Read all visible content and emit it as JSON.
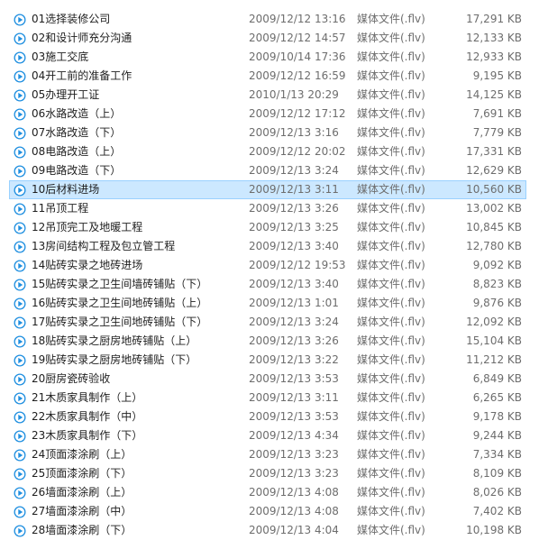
{
  "icon": {
    "name": "flv-video-icon",
    "color": "#1f8fe0"
  },
  "selected_index": 9,
  "files": [
    {
      "name": "01选择装修公司",
      "date": "2009/12/12 13:16",
      "type": "媒体文件(.flv)",
      "size": "17,291 KB"
    },
    {
      "name": "02和设计师充分沟通",
      "date": "2009/12/12 14:57",
      "type": "媒体文件(.flv)",
      "size": "12,133 KB"
    },
    {
      "name": "03施工交底",
      "date": "2009/10/14 17:36",
      "type": "媒体文件(.flv)",
      "size": "12,933 KB"
    },
    {
      "name": "04开工前的准备工作",
      "date": "2009/12/12 16:59",
      "type": "媒体文件(.flv)",
      "size": "9,195 KB"
    },
    {
      "name": "05办理开工证",
      "date": "2010/1/13 20:29",
      "type": "媒体文件(.flv)",
      "size": "14,125 KB"
    },
    {
      "name": "06水路改造（上）",
      "date": "2009/12/12 17:12",
      "type": "媒体文件(.flv)",
      "size": "7,691 KB"
    },
    {
      "name": "07水路改造（下）",
      "date": "2009/12/13 3:16",
      "type": "媒体文件(.flv)",
      "size": "7,779 KB"
    },
    {
      "name": "08电路改造（上）",
      "date": "2009/12/12 20:02",
      "type": "媒体文件(.flv)",
      "size": "17,331 KB"
    },
    {
      "name": "09电路改造（下）",
      "date": "2009/12/13 3:24",
      "type": "媒体文件(.flv)",
      "size": "12,629 KB"
    },
    {
      "name": "10后材料进场",
      "date": "2009/12/13 3:11",
      "type": "媒体文件(.flv)",
      "size": "10,560 KB"
    },
    {
      "name": "11吊顶工程",
      "date": "2009/12/13 3:26",
      "type": "媒体文件(.flv)",
      "size": "13,002 KB"
    },
    {
      "name": "12吊顶完工及地暖工程",
      "date": "2009/12/13 3:25",
      "type": "媒体文件(.flv)",
      "size": "10,845 KB"
    },
    {
      "name": "13房间结构工程及包立管工程",
      "date": "2009/12/13 3:40",
      "type": "媒体文件(.flv)",
      "size": "12,780 KB"
    },
    {
      "name": "14贴砖实录之地砖进场",
      "date": "2009/12/12 19:53",
      "type": "媒体文件(.flv)",
      "size": "9,092 KB"
    },
    {
      "name": "15贴砖实录之卫生间墙砖铺贴（下）",
      "date": "2009/12/13 3:40",
      "type": "媒体文件(.flv)",
      "size": "8,823 KB"
    },
    {
      "name": "16贴砖实录之卫生间地砖铺贴（上）",
      "date": "2009/12/13 1:01",
      "type": "媒体文件(.flv)",
      "size": "9,876 KB"
    },
    {
      "name": "17贴砖实录之卫生间地砖铺贴（下）",
      "date": "2009/12/13 3:24",
      "type": "媒体文件(.flv)",
      "size": "12,092 KB"
    },
    {
      "name": "18贴砖实录之厨房地砖铺贴（上）",
      "date": "2009/12/13 3:26",
      "type": "媒体文件(.flv)",
      "size": "15,104 KB"
    },
    {
      "name": "19贴砖实录之厨房地砖铺贴（下）",
      "date": "2009/12/13 3:22",
      "type": "媒体文件(.flv)",
      "size": "11,212 KB"
    },
    {
      "name": "20厨房瓷砖验收",
      "date": "2009/12/13 3:53",
      "type": "媒体文件(.flv)",
      "size": "6,849 KB"
    },
    {
      "name": "21木质家具制作（上）",
      "date": "2009/12/13 3:11",
      "type": "媒体文件(.flv)",
      "size": "6,265 KB"
    },
    {
      "name": "22木质家具制作（中）",
      "date": "2009/12/13 3:53",
      "type": "媒体文件(.flv)",
      "size": "9,178 KB"
    },
    {
      "name": "23木质家具制作（下）",
      "date": "2009/12/13 4:34",
      "type": "媒体文件(.flv)",
      "size": "9,244 KB"
    },
    {
      "name": "24顶面漆涂刷（上）",
      "date": "2009/12/13 3:23",
      "type": "媒体文件(.flv)",
      "size": "7,334 KB"
    },
    {
      "name": "25顶面漆涂刷（下）",
      "date": "2009/12/13 3:23",
      "type": "媒体文件(.flv)",
      "size": "8,109 KB"
    },
    {
      "name": "26墙面漆涂刷（上）",
      "date": "2009/12/13 4:08",
      "type": "媒体文件(.flv)",
      "size": "8,026 KB"
    },
    {
      "name": "27墙面漆涂刷（中）",
      "date": "2009/12/13 4:08",
      "type": "媒体文件(.flv)",
      "size": "7,402 KB"
    },
    {
      "name": "28墙面漆涂刷（下）",
      "date": "2009/12/13 4:04",
      "type": "媒体文件(.flv)",
      "size": "10,198 KB"
    }
  ]
}
